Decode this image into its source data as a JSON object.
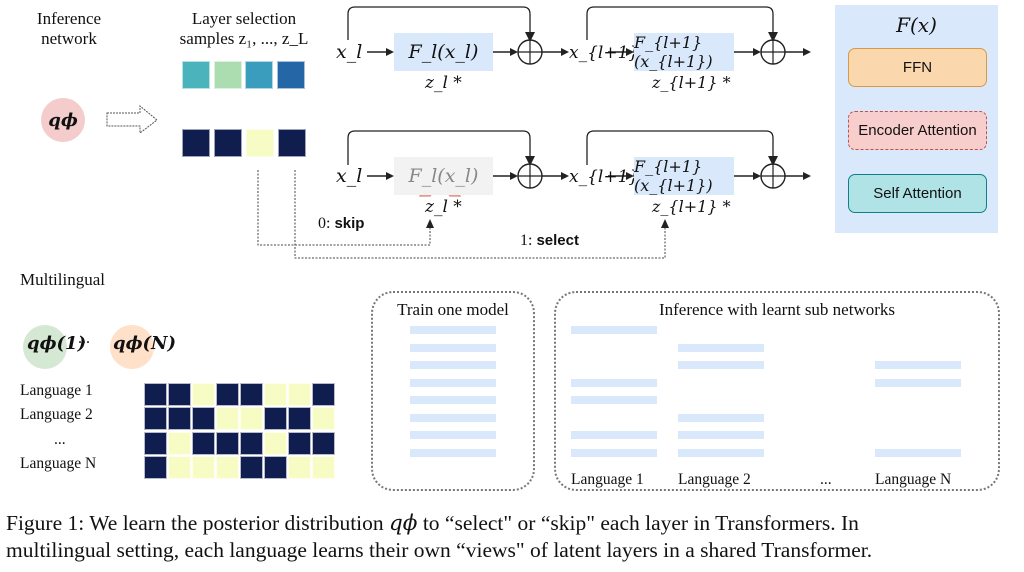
{
  "top_left": {
    "inference_label_line1": "Inference",
    "inference_label_line2": "network",
    "q_phi": "qϕ",
    "samples_label_line1": "Layer selection",
    "samples_label_line2": "samples z₁, ..., z_L",
    "sample_probs_colors": [
      "#4bb3bc",
      "#acddb0",
      "#3a9dbd",
      "#2466a6"
    ],
    "sample_binary": [
      1,
      1,
      0,
      1
    ],
    "binary_colors": {
      "select": "#0f1d4f",
      "skip": "#f7fbc4"
    }
  },
  "flow": {
    "row1": {
      "x_in": "x_l",
      "f1": "F_l(x_l)",
      "z1": "z_l *",
      "x_mid": "x_{l+1}",
      "f2": "F_{l+1}(x_{l+1})",
      "z2": "z_{l+1} *"
    },
    "row2": {
      "x_in": "x_l",
      "f1": "F_l(x_l)",
      "z1": "z_l *",
      "x_mid": "x_{l+1}",
      "f2": "F_{l+1}(x_{l+1})",
      "z2": "z_{l+1} *",
      "skipped_layer": 1
    },
    "skip_label_num": "0: ",
    "skip_label_word": "skip",
    "select_label_num": "1: ",
    "select_label_word": "select"
  },
  "fx_panel": {
    "title": "F(x)",
    "items": [
      {
        "label": "FFN",
        "fill": "#fad7ac",
        "border": "#d79b47",
        "style": "solid"
      },
      {
        "label": "Encoder Attention",
        "fill": "#f8cecc",
        "border": "#b85450",
        "style": "dashed"
      },
      {
        "label": "Self Attention",
        "fill": "#b0e3e6",
        "border": "#0e8088",
        "style": "solid"
      }
    ]
  },
  "multilingual": {
    "title": "Multilingual",
    "q_first": "qϕ(1)",
    "q_last": "qϕ(N)",
    "ellipsis": "...",
    "rows": [
      {
        "label": "Language 1",
        "mask": [
          1,
          1,
          0,
          1,
          1,
          0,
          0,
          1
        ]
      },
      {
        "label": "Language 2",
        "mask": [
          1,
          1,
          1,
          0,
          0,
          1,
          1,
          0
        ]
      },
      {
        "label": "...",
        "mask": [
          1,
          0,
          1,
          1,
          1,
          0,
          1,
          1
        ]
      },
      {
        "label": "Language N",
        "mask": [
          1,
          0,
          0,
          0,
          1,
          1,
          0,
          0
        ]
      }
    ]
  },
  "train_panel": {
    "title": "Train one model",
    "layers": 8
  },
  "inference_panel": {
    "title": "Inference with learnt sub networks",
    "columns": [
      {
        "label": "Language 1",
        "active_layers": [
          0,
          3,
          4,
          6,
          7
        ]
      },
      {
        "label": "Language 2",
        "active_layers": [
          1,
          2,
          5,
          6,
          7
        ]
      },
      {
        "label": "...",
        "active_layers": []
      },
      {
        "label": "Language N",
        "active_layers": [
          2,
          3,
          7
        ]
      }
    ]
  },
  "caption": {
    "line1_a": "Figure 1: We learn the posterior distribution ",
    "line1_q": "qϕ",
    "line1_b": " to “select\" or “skip\" each layer in Transformers. In",
    "line2": "multilingual setting, each language learns their own “views\" of latent layers in a shared Transformer."
  }
}
